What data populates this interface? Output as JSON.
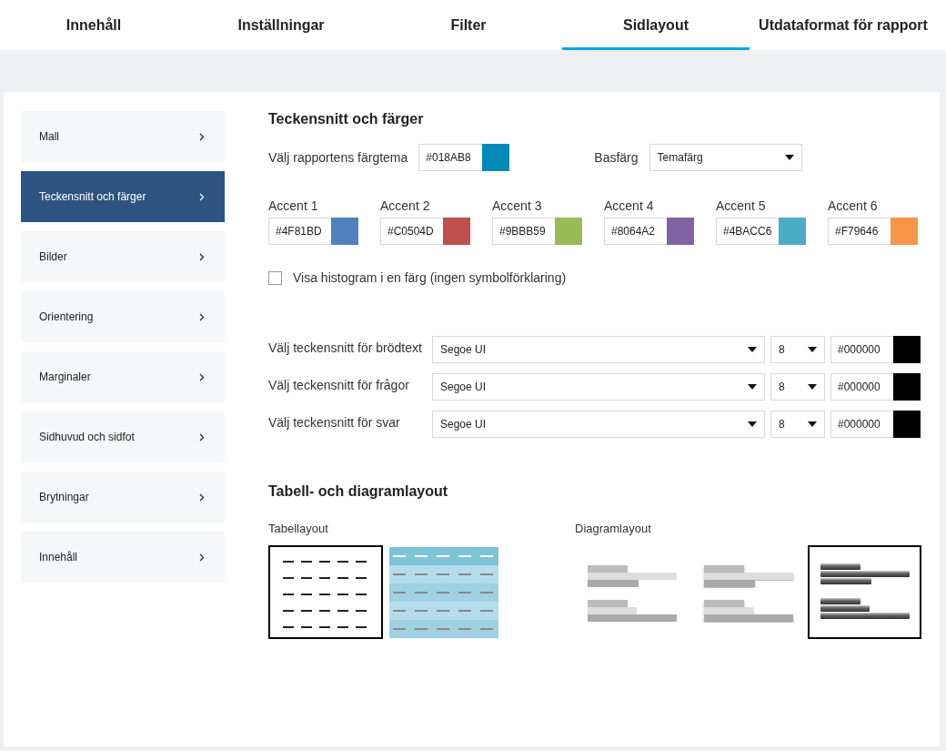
{
  "tabs": [
    {
      "label": "Innehåll",
      "selected": false
    },
    {
      "label": "Inställningar",
      "selected": false
    },
    {
      "label": "Filter",
      "selected": false
    },
    {
      "label": "Sidlayout",
      "selected": true
    },
    {
      "label": "Utdataformat för rapport",
      "selected": false
    }
  ],
  "sidebar": {
    "items": [
      {
        "label": "Mall",
        "selected": false
      },
      {
        "label": "Teckensnitt och färger",
        "selected": true
      },
      {
        "label": "Bilder",
        "selected": false
      },
      {
        "label": "Orientering",
        "selected": false
      },
      {
        "label": "Marginaler",
        "selected": false
      },
      {
        "label": "Sidhuvud och sidfot",
        "selected": false
      },
      {
        "label": "Brytningar",
        "selected": false
      },
      {
        "label": "Innehåll",
        "selected": false
      }
    ]
  },
  "fonts_colors": {
    "title": "Teckensnitt och färger",
    "theme": {
      "label": "Välj rapportens färgtema",
      "value": "#018AB8",
      "color": "#018ab8"
    },
    "base": {
      "label": "Basfärg",
      "value": "Temafärg"
    },
    "accents": [
      {
        "label": "Accent 1",
        "value": "#4F81BD",
        "color": "#4f81bd"
      },
      {
        "label": "Accent 2",
        "value": "#C0504D",
        "color": "#c0504d"
      },
      {
        "label": "Accent 3",
        "value": "#9BBB59",
        "color": "#9bbb59"
      },
      {
        "label": "Accent 4",
        "value": "#8064A2",
        "color": "#8064a2"
      },
      {
        "label": "Accent 5",
        "value": "#4BACC6",
        "color": "#4bacc6"
      },
      {
        "label": "Accent 6",
        "value": "#F79646",
        "color": "#f79646"
      }
    ],
    "histogram_checkbox": {
      "label": "Visa histogram i en färg (ingen symbolförklaring)",
      "checked": false
    },
    "font_rows": [
      {
        "label": "Välj teckensnitt för brödtext",
        "font": "Segoe UI",
        "size": "8",
        "value": "#000000",
        "color": "#000000"
      },
      {
        "label": "Välj teckensnitt för frågor",
        "font": "Segoe UI",
        "size": "8",
        "value": "#000000",
        "color": "#000000"
      },
      {
        "label": "Välj teckensnitt för svar",
        "font": "Segoe UI",
        "size": "8",
        "value": "#000000",
        "color": "#000000"
      }
    ]
  },
  "layouts": {
    "title": "Tabell- och diagramlayout",
    "table": {
      "label": "Tabellayout",
      "options": [
        {
          "kind": "plain",
          "selected": true
        },
        {
          "kind": "striped",
          "selected": false
        }
      ]
    },
    "chart": {
      "label": "Diagramlayout",
      "options": [
        {
          "kind": "flat",
          "selected": false
        },
        {
          "kind": "shadow",
          "selected": false
        },
        {
          "kind": "glossy",
          "selected": true
        }
      ]
    }
  }
}
